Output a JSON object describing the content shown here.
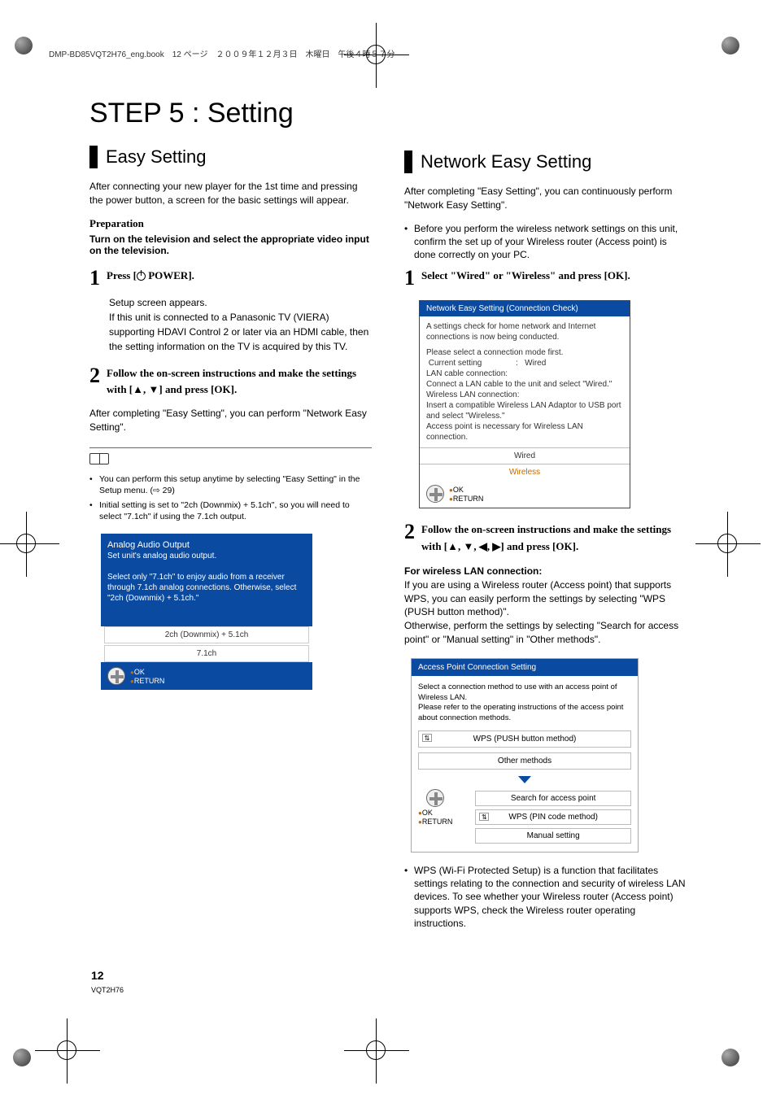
{
  "header_line": "DMP-BD85VQT2H76_eng.book　12 ページ　２００９年１２月３日　木曜日　午後４時５７分",
  "main_title": "STEP 5 : Setting",
  "left": {
    "section_title": "Easy Setting",
    "intro": "After connecting your new player for the 1st time and pressing the power button, a screen for the basic settings will appear.",
    "preparation_hd": "Preparation",
    "preparation_body": "Turn on the television and select the appropriate video input on the television.",
    "step1_label_a": "Press [",
    "step1_label_b": " POWER].",
    "step1_body": "Setup screen appears.\nIf this unit is connected to a Panasonic TV (VIERA) supporting HDAVI Control 2 or later via an HDMI cable, then the setting information on the TV is acquired by this TV.",
    "step2_label": "Follow the on-screen instructions and make the settings with [▲, ▼] and press [OK].",
    "after_text": "After completing \"Easy Setting\", you can perform \"Network Easy Setting\".",
    "notes": [
      "You can perform this setup anytime by selecting \"Easy Setting\" in the Setup menu. (⇨ 29)",
      "Initial setting is set to \"2ch (Downmix) + 5.1ch\", so you will need to select \"7.1ch\" if using the 7.1ch output."
    ],
    "screen": {
      "title": "Analog Audio Output",
      "sub": "Set unit's analog audio output.",
      "desc": "Select only \"7.1ch\" to enjoy audio from a receiver through 7.1ch analog connections. Otherwise, select \"2ch (Downmix) + 5.1ch.\"",
      "opt1": "2ch (Downmix) + 5.1ch",
      "opt2": "7.1ch",
      "ok": "OK",
      "ret": "RETURN"
    }
  },
  "right": {
    "section_title": "Network Easy Setting",
    "intro": "After completing \"Easy Setting\", you can continuously perform \"Network Easy Setting\".",
    "pre_bullet": "Before you perform the wireless network settings on this unit, confirm the set up of your Wireless router (Access point) is done correctly on your PC.",
    "step1_label": "Select \"Wired\" or \"Wireless\" and press [OK].",
    "screen1": {
      "title": "Network Easy Setting (Connection Check)",
      "l1": "A settings check for home network and Internet connections is now being conducted.",
      "l2": "Please select a connection mode first.",
      "l3": " Current setting               :   Wired",
      "l4": "LAN cable connection:",
      "l5": " Connect a LAN cable to the unit and select \"Wired.\"",
      "l6": "Wireless LAN connection:",
      "l7": " Insert a compatible Wireless LAN Adaptor to USB port and select \"Wireless.\"",
      "l8": " Access point is necessary for Wireless LAN connection.",
      "opt1": "Wired",
      "opt2": "Wireless",
      "ok": "OK",
      "ret": "RETURN"
    },
    "step2_label": "Follow the on-screen instructions and make the settings with [▲, ▼, ◀, ▶] and press [OK].",
    "wireless_hd": "For wireless LAN connection:",
    "wireless_body": "If you are using a Wireless router (Access point) that supports WPS, you can easily perform the settings by selecting \"WPS (PUSH button method)\".\nOtherwise, perform the settings by selecting \"Search for access point\" or \"Manual setting\" in \"Other methods\".",
    "screen2": {
      "title": "Access Point Connection Setting",
      "body": "Select a connection method to use with an access point of Wireless LAN.\nPlease refer to the operating instructions of the access point about connection methods.",
      "opt1": "WPS (PUSH button method)",
      "opt2": "Other methods",
      "sub1": "Search for access point",
      "sub2": "WPS (PIN code method)",
      "sub3": "Manual setting",
      "ok": "OK",
      "ret": "RETURN"
    },
    "wps_bullet": "WPS (Wi-Fi Protected Setup) is a function that facilitates settings relating to the connection and security of wireless LAN devices. To see whether your Wireless router (Access point) supports WPS, check the Wireless router operating instructions."
  },
  "page": {
    "num": "12",
    "code": "VQT2H76"
  }
}
